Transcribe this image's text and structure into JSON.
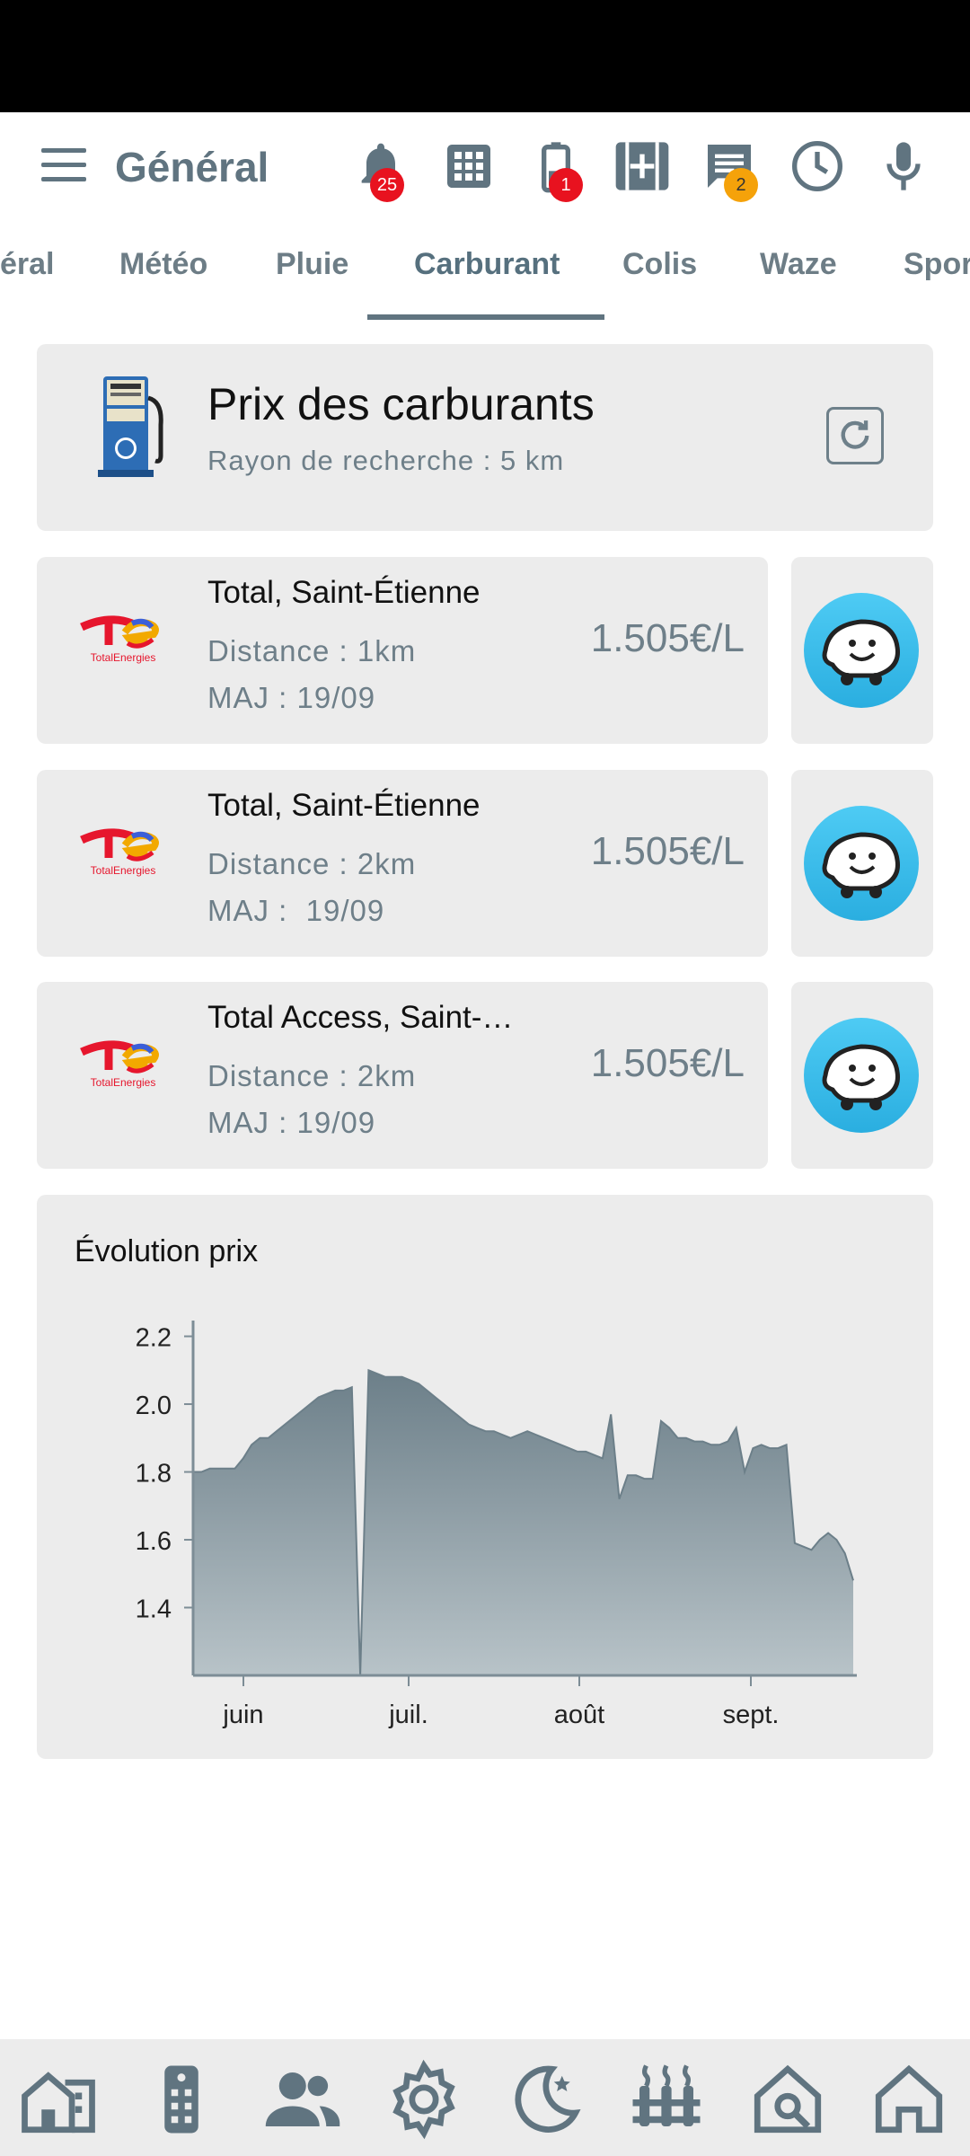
{
  "app": {
    "title": "Général"
  },
  "header_icons": [
    {
      "name": "bell-icon",
      "badge": "25"
    },
    {
      "name": "grid-icon"
    },
    {
      "name": "battery-icon",
      "badge": "1"
    },
    {
      "name": "medical-box-icon"
    },
    {
      "name": "message-icon",
      "badge": "2"
    },
    {
      "name": "clock-icon"
    },
    {
      "name": "microphone-icon"
    }
  ],
  "tabs": [
    {
      "label": "éral"
    },
    {
      "label": "Météo"
    },
    {
      "label": "Pluie"
    },
    {
      "label": "Carburant",
      "active": true
    },
    {
      "label": "Colis"
    },
    {
      "label": "Waze"
    },
    {
      "label": "Spor"
    }
  ],
  "fuel": {
    "title": "Prix des carburants",
    "subtitle": "Rayon de recherche : 5 km",
    "stations": [
      {
        "name": "Total, Saint-Étienne",
        "distance": "Distance : 1km",
        "updated": "MAJ : 19/09",
        "price": "1.505€/L"
      },
      {
        "name": "Total, Saint-Étienne",
        "distance": "Distance : 2km",
        "updated": "MAJ :  19/09",
        "price": "1.505€/L"
      },
      {
        "name": "Total Access, Saint-…",
        "distance": "Distance : 2km",
        "updated": "MAJ : 19/09",
        "price": "1.505€/L"
      }
    ]
  },
  "chart_card": {
    "title": "Évolution prix"
  },
  "chart_data": {
    "type": "area",
    "title": "Évolution prix",
    "xlabel": "",
    "ylabel": "",
    "x_ticks": [
      "juin",
      "juil.",
      "août",
      "sept."
    ],
    "y_ticks": [
      "2.2",
      "2.0",
      "1.8",
      "1.6",
      "1.4"
    ],
    "ylim": [
      1.2,
      2.22
    ],
    "grid": false,
    "color": "#6c7f89",
    "series": [
      {
        "values": [
          1.8,
          1.8,
          1.81,
          1.81,
          1.81,
          1.81,
          1.84,
          1.88,
          1.9,
          1.9,
          1.92,
          1.94,
          1.96,
          1.98,
          2.0,
          2.02,
          2.03,
          2.04,
          2.04,
          2.05,
          1.2,
          2.1,
          2.09,
          2.08,
          2.08,
          2.08,
          2.07,
          2.06,
          2.04,
          2.02,
          2.0,
          1.98,
          1.96,
          1.94,
          1.93,
          1.92,
          1.92,
          1.91,
          1.9,
          1.91,
          1.92,
          1.91,
          1.9,
          1.89,
          1.88,
          1.87,
          1.86,
          1.86,
          1.85,
          1.84,
          1.97,
          1.72,
          1.79,
          1.79,
          1.78,
          1.78,
          1.95,
          1.93,
          1.9,
          1.9,
          1.89,
          1.89,
          1.88,
          1.88,
          1.89,
          1.93,
          1.8,
          1.87,
          1.88,
          1.87,
          1.87,
          1.88,
          1.59,
          1.58,
          1.57,
          1.6,
          1.62,
          1.6,
          1.56,
          1.48
        ]
      }
    ]
  },
  "bottom_nav": [
    {
      "name": "buildings-icon"
    },
    {
      "name": "remote-control-icon"
    },
    {
      "name": "people-icon"
    },
    {
      "name": "settings-gear-icon"
    },
    {
      "name": "night-moon-icon"
    },
    {
      "name": "heater-icon"
    },
    {
      "name": "home-search-icon"
    },
    {
      "name": "home-icon"
    }
  ],
  "colors": {
    "accent": "#607480",
    "card_bg": "#ececec",
    "muted_text": "#6e7f89",
    "waze_blue": "#33bdef"
  }
}
